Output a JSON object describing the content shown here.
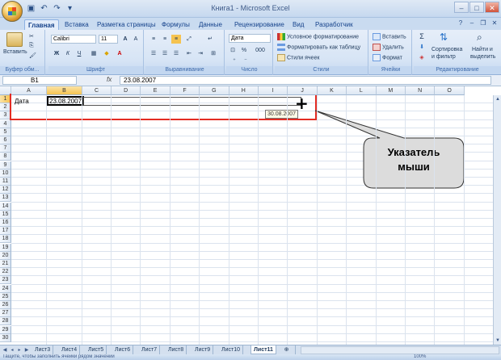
{
  "window": {
    "title": "Книга1 - Microsoft Excel"
  },
  "qat_icons": [
    "save-icon",
    "undo-icon",
    "redo-icon",
    "customize-icon"
  ],
  "tabs": [
    "Главная",
    "Вставка",
    "Разметка страницы",
    "Формулы",
    "Данные",
    "Рецензирование",
    "Вид",
    "Разработчик"
  ],
  "ribbon": {
    "clipboard": {
      "paste": "Вставить",
      "label": "Буфер обм..."
    },
    "font": {
      "name": "Calibri",
      "size": "11",
      "label": "Шрифт",
      "bold": "Ж",
      "italic": "К",
      "underline": "Ч",
      "grow": "A",
      "shrink": "A"
    },
    "alignment": {
      "label": "Выравнивание"
    },
    "number": {
      "format": "Дата",
      "percent": "%",
      "thousands": "000",
      "label": "Число"
    },
    "styles": {
      "conditional": "Условное форматирование",
      "table": "Форматировать как таблицу",
      "cell": "Стили ячеек",
      "label": "Стили"
    },
    "cells": {
      "insert": "Вставить",
      "delete": "Удалить",
      "format": "Формат",
      "label": "Ячейки"
    },
    "editing": {
      "sort": "Сортировка",
      "sort2": "и фильтр",
      "find": "Найти и",
      "find2": "выделить",
      "label": "Редактирование"
    }
  },
  "formula_bar": {
    "name_box": "B1",
    "fx": "fx",
    "value": "23.08.2007"
  },
  "columns": [
    "A",
    "B",
    "C",
    "D",
    "E",
    "F",
    "G",
    "H",
    "I",
    "J",
    "K",
    "L",
    "M",
    "N",
    "O"
  ],
  "rows": [
    "1",
    "2",
    "3",
    "4",
    "5",
    "6",
    "7",
    "8",
    "9",
    "10",
    "11",
    "12",
    "13",
    "14",
    "15",
    "16",
    "17",
    "18",
    "19",
    "20",
    "21",
    "22",
    "23",
    "24",
    "25",
    "26",
    "27",
    "28",
    "29",
    "30"
  ],
  "cells": {
    "A1": "Дата",
    "B1": "23.08.2007"
  },
  "tooltip": "30.08.2007",
  "callout": {
    "line1": "Указатель",
    "line2": "мыши"
  },
  "sheets": [
    "Лист3",
    "Лист4",
    "Лист5",
    "Лист6",
    "Лист7",
    "Лист8",
    "Лист9",
    "Лист10",
    "Лист11"
  ],
  "active_sheet": "Лист11",
  "status": {
    "text": "Тащите, чтобы заполнить ячейки рядом значений",
    "zoom": "100%"
  },
  "colors": {
    "highlight": "#e32c23",
    "ribbon": "#d6e4f5",
    "callout": "#e0e0e0"
  }
}
